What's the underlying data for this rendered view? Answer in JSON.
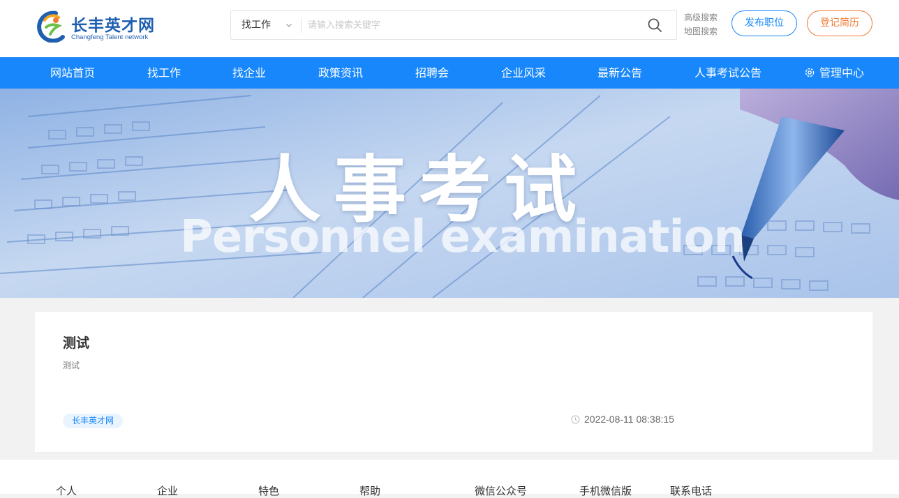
{
  "header": {
    "logo_cn": "长丰英才网",
    "logo_en": "Changfeng Talent network",
    "search_type": "找工作",
    "search_placeholder": "请输入搜索关键字",
    "advanced_search": "高级搜索",
    "map_search": "地图搜索",
    "post_job": "发布职位",
    "register_resume": "登记简历"
  },
  "nav": {
    "items": [
      "网站首页",
      "找工作",
      "找企业",
      "政策资讯",
      "招聘会",
      "企业风采",
      "最新公告",
      "人事考试公告",
      "管理中心"
    ]
  },
  "banner": {
    "title": "人事考试",
    "subtitle": "Personnel examination"
  },
  "article": {
    "title": "测试",
    "description": "测试",
    "source_tag": "长丰英才网",
    "datetime": "2022-08-11 08:38:15"
  },
  "footer": {
    "columns": [
      "个人",
      "企业",
      "特色",
      "帮助",
      "微信公众号",
      "手机微信版",
      "联系电话"
    ]
  },
  "colors": {
    "primary": "#1787fb",
    "accent": "#f07a35",
    "logo_blue": "#1f5fb0"
  }
}
